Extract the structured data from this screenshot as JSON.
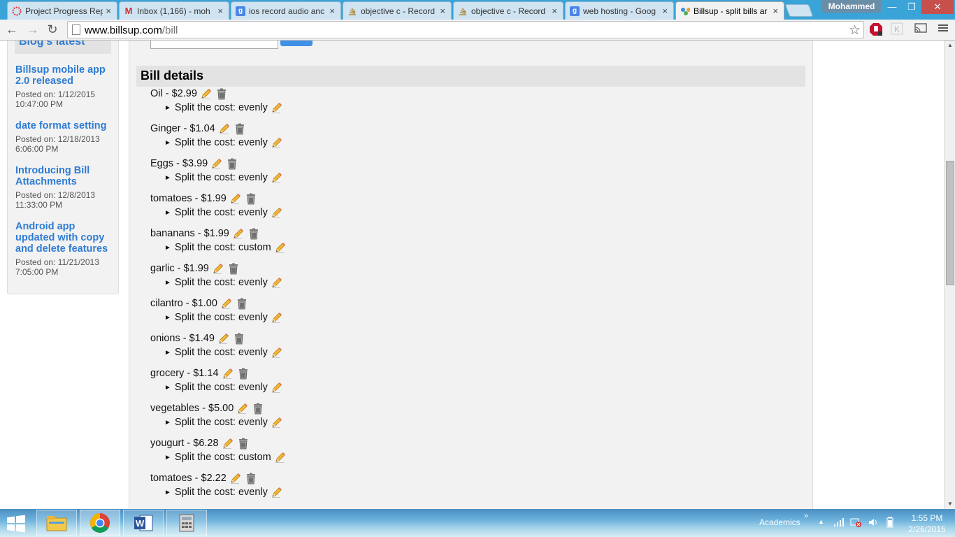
{
  "browser": {
    "tabs": [
      {
        "title": "Project Progress Rep",
        "icon": "circle-icon"
      },
      {
        "title": "Inbox (1,166) - moh",
        "icon": "gmail-icon"
      },
      {
        "title": "ios record audio anc",
        "icon": "google-icon"
      },
      {
        "title": "objective c - Record",
        "icon": "stackoverflow-icon"
      },
      {
        "title": "objective c - Record",
        "icon": "stackoverflow-icon"
      },
      {
        "title": "web hosting - Goog",
        "icon": "google-icon"
      },
      {
        "title": "Billsup - split bills ar",
        "icon": "billsup-icon"
      }
    ],
    "tab_close": "×",
    "profile_name": "Mohammed",
    "url_host": "www.billsup.com",
    "url_path": "/bill"
  },
  "sidebar": {
    "heading": "Blog's latest",
    "posts": [
      {
        "title": "Billsup mobile app 2.0 released",
        "date": "Posted on: 1/12/2015 10:47:00 PM"
      },
      {
        "title": "date format setting",
        "date": "Posted on: 12/18/2013 6:06:00 PM"
      },
      {
        "title": "Introducing Bill Attachments",
        "date": "Posted on: 12/8/2013 11:33:00 PM"
      },
      {
        "title": "Android app updated with copy and delete features",
        "date": "Posted on: 11/21/2013 7:05:00 PM"
      }
    ]
  },
  "bill": {
    "heading": "Bill details",
    "items": [
      {
        "label": "Oil - $2.99",
        "split": "Split the cost: evenly"
      },
      {
        "label": "Ginger - $1.04",
        "split": "Split the cost: evenly"
      },
      {
        "label": "Eggs - $3.99",
        "split": "Split the cost: evenly"
      },
      {
        "label": "tomatoes - $1.99",
        "split": "Split the cost: evenly"
      },
      {
        "label": "bananans - $1.99",
        "split": "Split the cost: custom"
      },
      {
        "label": "garlic - $1.99",
        "split": "Split the cost: evenly"
      },
      {
        "label": "cilantro - $1.00",
        "split": "Split the cost: evenly"
      },
      {
        "label": "onions - $1.49",
        "split": "Split the cost: evenly"
      },
      {
        "label": "grocery - $1.14",
        "split": "Split the cost: evenly"
      },
      {
        "label": "vegetables - $5.00",
        "split": "Split the cost: evenly"
      },
      {
        "label": "yougurt - $6.28",
        "split": "Split the cost: custom"
      },
      {
        "label": "tomatoes - $2.22",
        "split": "Split the cost: evenly"
      }
    ]
  },
  "taskbar": {
    "apps": [
      "file-explorer-icon",
      "chrome-icon",
      "word-icon",
      "calculator-icon"
    ],
    "toolbar_label": "Academics",
    "time": "1:55 PM",
    "date": "2/26/2015"
  },
  "colors": {
    "link_blue": "#2f7cd3",
    "panel_gray": "#f2f2f2",
    "header_gray": "#e3e3e3",
    "tabstrip_blue": "#3aa3d8"
  }
}
